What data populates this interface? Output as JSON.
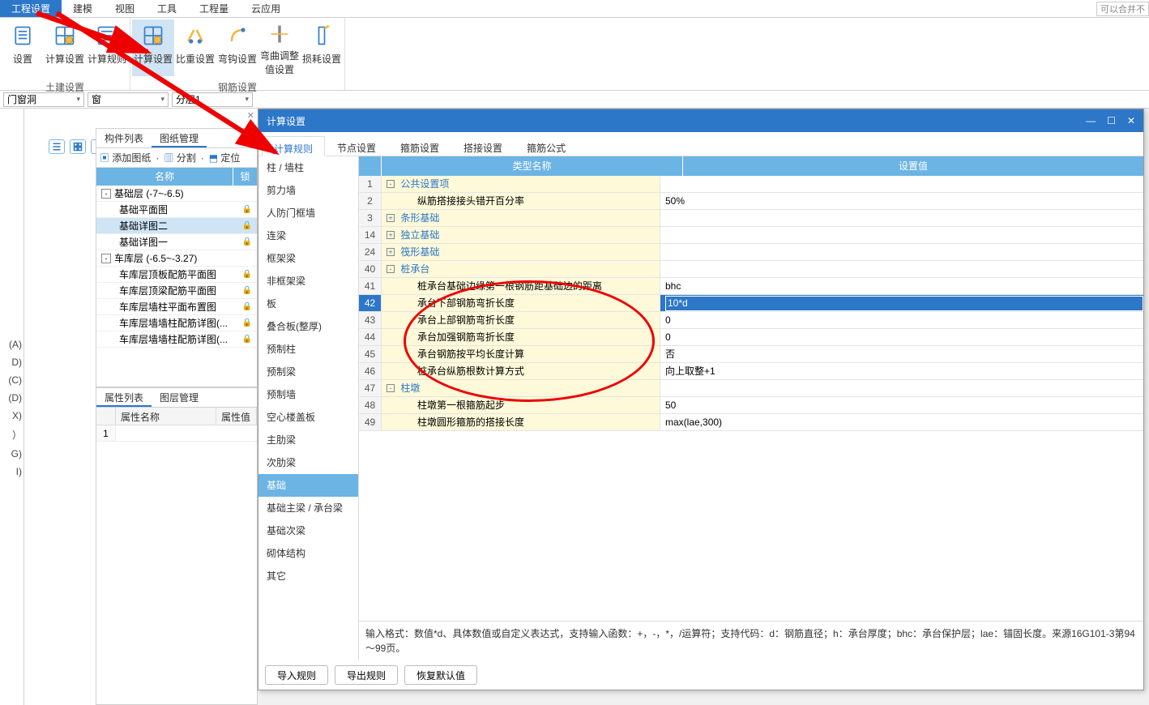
{
  "menubar": {
    "items": [
      "工程设置",
      "建模",
      "视图",
      "工具",
      "工程量",
      "云应用"
    ],
    "right": "可以合并不"
  },
  "ribbon": {
    "groups": [
      {
        "title": "土建设置",
        "buttons": [
          "设置",
          "计算设置",
          "计算规则"
        ]
      },
      {
        "title": "钢筋设置",
        "buttons": [
          "计算设置",
          "比重设置",
          "弯钩设置",
          "弯曲调整值设置",
          "损耗设置"
        ]
      }
    ]
  },
  "strip": {
    "sel1": "门窗洞",
    "sel2": "窗",
    "sel3": "分层1"
  },
  "leftcol": [
    "(A)",
    "D)",
    "(C)",
    "(D)",
    "X)",
    "）",
    "G)",
    "I)"
  ],
  "sidepanel": {
    "tabs": [
      "构件列表",
      "图纸管理"
    ],
    "toolbar": {
      "add": "添加图纸",
      "split": "分割",
      "locate": "定位"
    },
    "header": {
      "name": "名称",
      "lock": "锁"
    },
    "tree": [
      {
        "type": "group",
        "label": "基础层 (-7~-6.5)",
        "exp": "-"
      },
      {
        "type": "leaf",
        "label": "基础平面图",
        "lock": true
      },
      {
        "type": "leaf",
        "label": "基础详图二",
        "sel": true,
        "lock": true
      },
      {
        "type": "leaf",
        "label": "基础详图一",
        "lock": true
      },
      {
        "type": "group",
        "label": "车库层 (-6.5~-3.27)",
        "exp": "-"
      },
      {
        "type": "leaf",
        "label": "车库层顶板配筋平面图",
        "lock": true
      },
      {
        "type": "leaf",
        "label": "车库层顶梁配筋平面图",
        "lock": true
      },
      {
        "type": "leaf",
        "label": "车库层墙柱平面布置图",
        "lock": true
      },
      {
        "type": "leaf",
        "label": "车库层墙墙柱配筋详图(...",
        "lock": true
      },
      {
        "type": "leaf",
        "label": "车库层墙墙柱配筋详图(...",
        "lock": true
      }
    ]
  },
  "proppanel": {
    "tabs": [
      "属性列表",
      "图层管理"
    ],
    "header": {
      "name": "属性名称",
      "val": "属性值"
    },
    "rows": [
      {
        "n": "1"
      }
    ]
  },
  "modal": {
    "title": "计算设置",
    "tabs": [
      "计算规则",
      "节点设置",
      "箍筋设置",
      "搭接设置",
      "箍筋公式"
    ],
    "categories": [
      "柱 / 墙柱",
      "剪力墙",
      "人防门框墙",
      "连梁",
      "框架梁",
      "非框架梁",
      "板",
      "叠合板(整厚)",
      "预制柱",
      "预制梁",
      "预制墙",
      "空心楼盖板",
      "主肋梁",
      "次肋梁",
      "基础",
      "基础主梁 / 承台梁",
      "基础次梁",
      "砌体结构",
      "其它"
    ],
    "cat_sel": 14,
    "grid": {
      "head": {
        "name": "类型名称",
        "val": "设置值"
      },
      "rows": [
        {
          "n": "1",
          "type": "group",
          "exp": "-",
          "name": "公共设置项"
        },
        {
          "n": "2",
          "type": "leaf",
          "name": "纵筋搭接接头错开百分率",
          "val": "50%"
        },
        {
          "n": "3",
          "type": "group",
          "exp": "+",
          "name": "条形基础"
        },
        {
          "n": "14",
          "type": "group",
          "exp": "+",
          "name": "独立基础"
        },
        {
          "n": "24",
          "type": "group",
          "exp": "+",
          "name": "筏形基础"
        },
        {
          "n": "40",
          "type": "group",
          "exp": "-",
          "name": "桩承台"
        },
        {
          "n": "41",
          "type": "leaf",
          "name": "桩承台基础边缘第一根钢筋距基础边的距离",
          "val": "bhc"
        },
        {
          "n": "42",
          "type": "leaf",
          "name": "承台下部钢筋弯折长度",
          "val": "10*d",
          "sel": true
        },
        {
          "n": "43",
          "type": "leaf",
          "name": "承台上部钢筋弯折长度",
          "val": "0"
        },
        {
          "n": "44",
          "type": "leaf",
          "name": "承台加强钢筋弯折长度",
          "val": "0"
        },
        {
          "n": "45",
          "type": "leaf",
          "name": "承台钢筋按平均长度计算",
          "val": "否"
        },
        {
          "n": "46",
          "type": "leaf",
          "name": "桩承台纵筋根数计算方式",
          "val": "向上取整+1"
        },
        {
          "n": "47",
          "type": "group",
          "exp": "-",
          "name": "柱墩"
        },
        {
          "n": "48",
          "type": "leaf",
          "name": "柱墩第一根箍筋起步",
          "val": "50"
        },
        {
          "n": "49",
          "type": "leaf",
          "name": "柱墩圆形箍筋的搭接长度",
          "val": "max(lae,300)"
        }
      ],
      "footer": "输入格式：数值*d、具体数值或自定义表达式，支持输入函数：+，-，*，/运算符；支持代码：d：钢筋直径；h：承台厚度；bhc：承台保护层；lae：锚固长度。来源16G101-3第94～99页。"
    },
    "buttons": [
      "导入规则",
      "导出规则",
      "恢复默认值"
    ]
  }
}
